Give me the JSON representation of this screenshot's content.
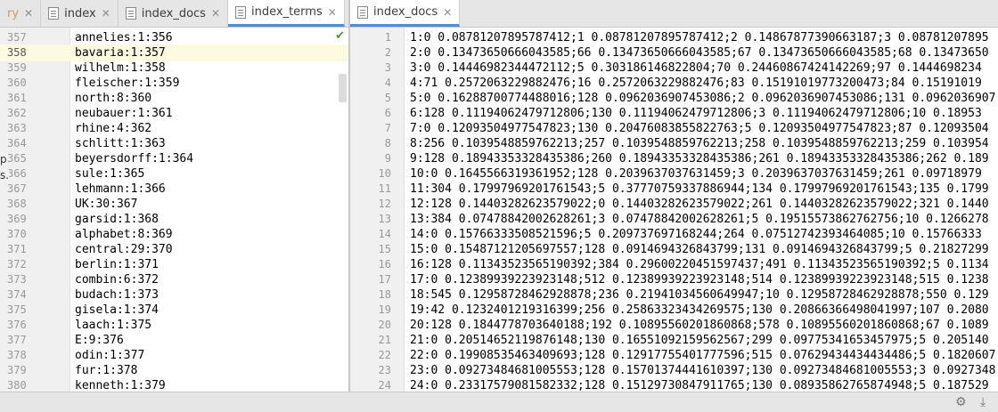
{
  "left_tabs": [
    {
      "label": "ry",
      "faded": true
    },
    {
      "label": "index"
    },
    {
      "label": "index_docs"
    },
    {
      "label": "index_terms",
      "active": true
    }
  ],
  "overflow_label": "▾≡7",
  "right_tabs": [
    {
      "label": "index_docs",
      "active": true
    }
  ],
  "left_editor": {
    "current_line": 358,
    "lines": [
      {
        "n": "357",
        "t": "annelies:1:356"
      },
      {
        "n": "358",
        "t": "bavaria:1:357"
      },
      {
        "n": "359",
        "t": "wilhelm:1:358"
      },
      {
        "n": "360",
        "t": "fleischer:1:359"
      },
      {
        "n": "361",
        "t": "north:8:360"
      },
      {
        "n": "362",
        "t": "neubauer:1:361"
      },
      {
        "n": "363",
        "t": "rhine:4:362"
      },
      {
        "n": "364",
        "t": "schlitt:1:363"
      },
      {
        "n": "365",
        "t": "beyersdorff:1:364"
      },
      {
        "n": "366",
        "t": "sule:1:365"
      },
      {
        "n": "367",
        "t": "lehmann:1:366"
      },
      {
        "n": "368",
        "t": "UK:30:367"
      },
      {
        "n": "369",
        "t": "garsid:1:368"
      },
      {
        "n": "370",
        "t": "alphabet:8:369"
      },
      {
        "n": "371",
        "t": "central:29:370"
      },
      {
        "n": "372",
        "t": "berlin:1:371"
      },
      {
        "n": "373",
        "t": "combin:6:372"
      },
      {
        "n": "374",
        "t": "budach:1:373"
      },
      {
        "n": "375",
        "t": "gisela:1:374"
      },
      {
        "n": "376",
        "t": "laach:1:375"
      },
      {
        "n": "377",
        "t": "E:9:376"
      },
      {
        "n": "378",
        "t": "odin:1:377"
      },
      {
        "n": "379",
        "t": "fur:1:378"
      },
      {
        "n": "380",
        "t": "kenneth:1:379"
      }
    ]
  },
  "right_editor": {
    "lines": [
      {
        "n": "1",
        "t": "1:0 0.08781207895787412;1 0.08781207895787412;2 0.14867877390663187;3 0.08781207895"
      },
      {
        "n": "2",
        "t": "2:0 0.13473650666043585;66 0.13473650666043585;67 0.13473650666043585;68 0.13473650"
      },
      {
        "n": "3",
        "t": "3:0 0.14446982344472112;5 0.303186146822804;70 0.24460867424142269;97 0.1444698234"
      },
      {
        "n": "4",
        "t": "4:71 0.2572063229882476;16 0.2572063229882476;83 0.15191019773200473;84 0.15191019"
      },
      {
        "n": "5",
        "t": "5:0 0.16288700774488016;128 0.0962036907453086;2 0.0962036907453086;131 0.0962036907"
      },
      {
        "n": "6",
        "t": "6:128 0.11194062479712806;130 0.11194062479712806;3 0.11194062479712806;10 0.18953"
      },
      {
        "n": "7",
        "t": "7:0 0.12093504977547823;130 0.20476083855822763;5 0.12093504977547823;87 0.12093504"
      },
      {
        "n": "8",
        "t": "8:256 0.1039548859762213;257 0.1039548859762213;258 0.1039548859762213;259 0.103954"
      },
      {
        "n": "9",
        "t": "9:128 0.18943353328435386;260 0.18943353328435386;261 0.18943353328435386;262 0.189"
      },
      {
        "n": "10",
        "t": "10:0 0.1645566319361952;128 0.2039637037631459;3 0.2039637037631459;261 0.09718979"
      },
      {
        "n": "11",
        "t": "11:304 0.17997969201761543;5 0.37770759337886944;134 0.17997969201761543;135 0.1799"
      },
      {
        "n": "12",
        "t": "12:128 0.14403282623579022;0 0.14403282623579022;261 0.14403282623579022;321 0.1440"
      },
      {
        "n": "13",
        "t": "13:384 0.07478842002628261;3 0.07478842002628261;5 0.19515573862762756;10 0.1266278"
      },
      {
        "n": "14",
        "t": "14:0 0.15766333508521596;5 0.209737697168244;264 0.07512742393464085;10 0.15766333"
      },
      {
        "n": "15",
        "t": "15:0 0.15487121205697557;128 0.0914694326843799;131 0.0914694326843799;5 0.21827299"
      },
      {
        "n": "16",
        "t": "16:128 0.11343523565190392;384 0.29600220451597437;491 0.11343523565190392;5 0.1134"
      },
      {
        "n": "17",
        "t": "17:0 0.12389939223923148;512 0.12389939223923148;514 0.12389939223923148;515 0.1238"
      },
      {
        "n": "18",
        "t": "18:545 0.12958728462928878;236 0.21941034560649947;10 0.12958728462928878;550 0.129"
      },
      {
        "n": "19",
        "t": "19:42 0.1232401219316399;256 0.25863323434269575;130 0.20866366498041997;107 0.2080"
      },
      {
        "n": "20",
        "t": "20:128 0.1844778703640188;192 0.10895560201860868;578 0.10895560201860868;67 0.1089"
      },
      {
        "n": "21",
        "t": "21:0 0.20514652119876148;130 0.16551092159562567;299 0.09775341653457975;5 0.205140"
      },
      {
        "n": "22",
        "t": "22:0 0.19908535463409693;128 0.12917755401777596;515 0.07629434434434486;5 0.1820607"
      },
      {
        "n": "23",
        "t": "23:0 0.09273484681005553;128 0.15701374441610397;130 0.09273484681005553;3 0.0927348"
      },
      {
        "n": "24",
        "t": "24:0 0.23317579081582332;128 0.15129730847911765;130 0.08935862765874948;5 0.187529"
      }
    ]
  },
  "edge_fragments": [
    "p",
    "s."
  ],
  "icons": {
    "check": "check-icon",
    "settings": "gear-icon",
    "download": "download-icon"
  }
}
